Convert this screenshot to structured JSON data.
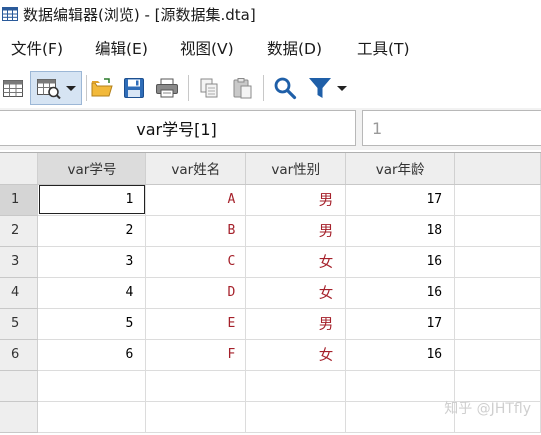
{
  "window": {
    "title": "数据编辑器(浏览) - [源数据集.dta]",
    "app_icon": "table-icon"
  },
  "menu": [
    "文件(F)",
    "编辑(E)",
    "视图(V)",
    "数据(D)",
    "工具(T)"
  ],
  "toolbar": {
    "icons": [
      "table-icon",
      "table-view-icon",
      "chevron-down-icon",
      "open-folder-icon",
      "save-icon",
      "print-icon",
      "copy-icon",
      "paste-icon",
      "search-icon",
      "filter-icon",
      "chevron-down-icon"
    ],
    "pressed": "table-view-icon"
  },
  "varbar": {
    "varname": "var学号[1]",
    "value": "1"
  },
  "columns": [
    "var学号",
    "var姓名",
    "var性别",
    "var年龄"
  ],
  "rows": [
    {
      "num": "1",
      "cells": [
        "1",
        "A",
        "男",
        "17"
      ]
    },
    {
      "num": "2",
      "cells": [
        "2",
        "B",
        "男",
        "18"
      ]
    },
    {
      "num": "3",
      "cells": [
        "3",
        "C",
        "女",
        "16"
      ]
    },
    {
      "num": "4",
      "cells": [
        "4",
        "D",
        "女",
        "16"
      ]
    },
    {
      "num": "5",
      "cells": [
        "5",
        "E",
        "男",
        "17"
      ]
    },
    {
      "num": "6",
      "cells": [
        "6",
        "F",
        "女",
        "16"
      ]
    }
  ],
  "watermark": "知乎 @JHTfly",
  "colors": {
    "string_text": "#a5202a",
    "header_bg": "#eeeeee",
    "toolbar_accent": "#1f5fa8"
  }
}
